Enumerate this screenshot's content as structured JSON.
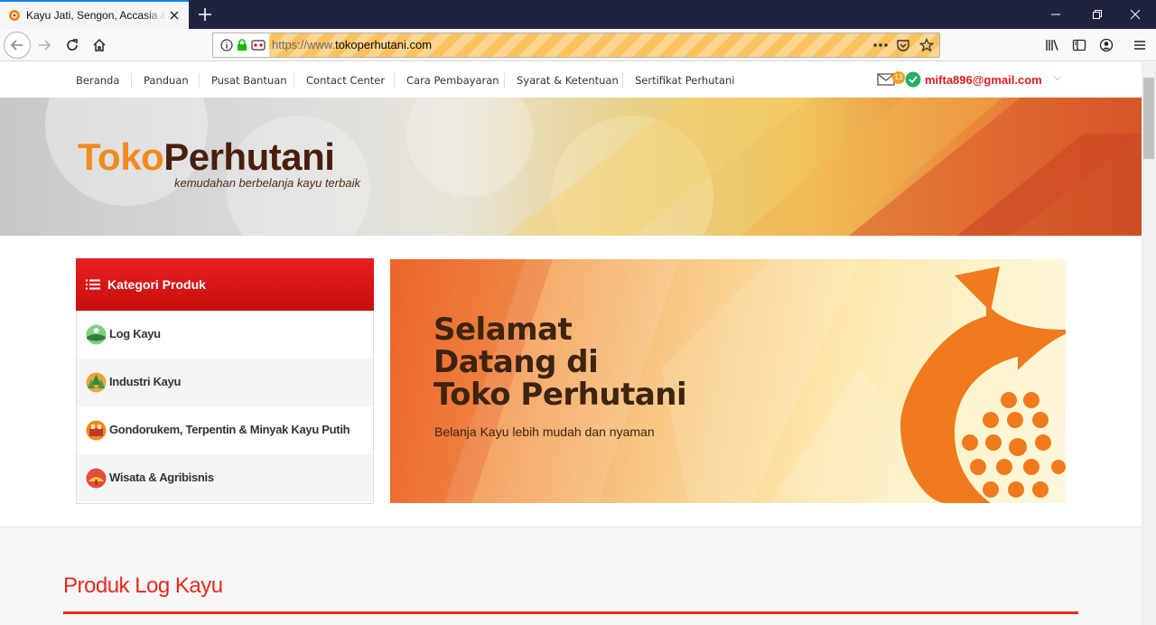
{
  "browser": {
    "tab_title": "Kayu Jati, Sengon, Accasia & Lainnya",
    "url_scheme": "https://www.",
    "url_host": "tokoperhutani.com"
  },
  "site": {
    "topnav": [
      "Beranda",
      "Panduan",
      "Pusat Bantuan",
      "Contact Center",
      "Cara Pembayaran",
      "Syarat & Ketentuan",
      "Sertifikat Perhutani"
    ],
    "user_email": "mifta896@gmail.com",
    "notif_count": "13",
    "logo_toko": "Toko",
    "logo_perhutani": "Perhutani",
    "tagline": "kemudahan berbelanja kayu terbaik",
    "sidebar_title": "Kategori Produk",
    "categories": [
      "Log Kayu",
      "Industri Kayu",
      "Gondorukem, Terpentin & Minyak Kayu Putih",
      "Wisata & Agribisnis"
    ],
    "banner_line1": "Selamat",
    "banner_line2": "Datang di",
    "banner_line3": "Toko Perhutani",
    "banner_sub": "Belanja Kayu lebih mudah dan nyaman",
    "section_title": "Produk Log Kayu"
  },
  "colors": {
    "accent_red": "#e21b1b",
    "logo_orange": "#f08a1c",
    "logo_brown": "#4a1e0c",
    "tab_bar": "#202340"
  }
}
